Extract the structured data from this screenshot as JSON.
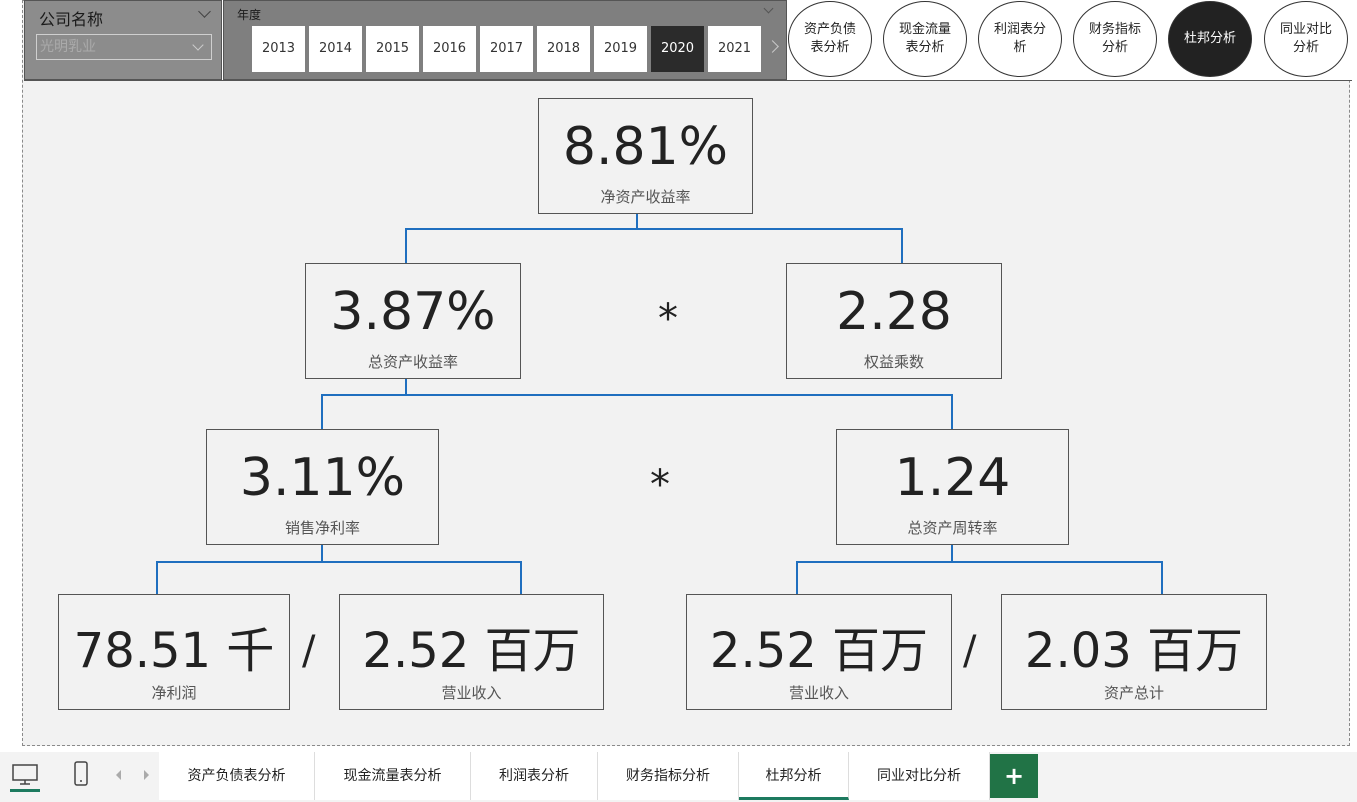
{
  "header": {
    "company_label": "公司名称",
    "company_value": "光明乳业",
    "year_label": "年度",
    "years": [
      "2013",
      "2014",
      "2015",
      "2016",
      "2017",
      "2018",
      "2019",
      "2020",
      "2021"
    ],
    "active_year": "2020",
    "nav": [
      "资产负债表分析",
      "现金流量表分析",
      "利润表分析",
      "财务指标分析",
      "杜邦分析",
      "同业对比分析"
    ],
    "active_nav": "杜邦分析"
  },
  "tree": {
    "roe": {
      "value": "8.81%",
      "label": "净资产收益率"
    },
    "roa": {
      "value": "3.87%",
      "label": "总资产收益率"
    },
    "equity_multiplier": {
      "value": "2.28",
      "label": "权益乘数"
    },
    "net_margin": {
      "value": "3.11%",
      "label": "销售净利率"
    },
    "asset_turnover": {
      "value": "1.24",
      "label": "总资产周转率"
    },
    "net_profit": {
      "value": "78.51 千",
      "label": "净利润"
    },
    "revenue_left": {
      "value": "2.52 百万",
      "label": "营业收入"
    },
    "revenue_right": {
      "value": "2.52 百万",
      "label": "营业收入"
    },
    "total_assets": {
      "value": "2.03 百万",
      "label": "资产总计"
    },
    "op_multiply": "*",
    "op_divide": "/"
  },
  "bottom": {
    "tabs": [
      "资产负债表分析",
      "现金流量表分析",
      "利润表分析",
      "财务指标分析",
      "杜邦分析",
      "同业对比分析"
    ],
    "active_tab": "杜邦分析",
    "add": "+"
  }
}
